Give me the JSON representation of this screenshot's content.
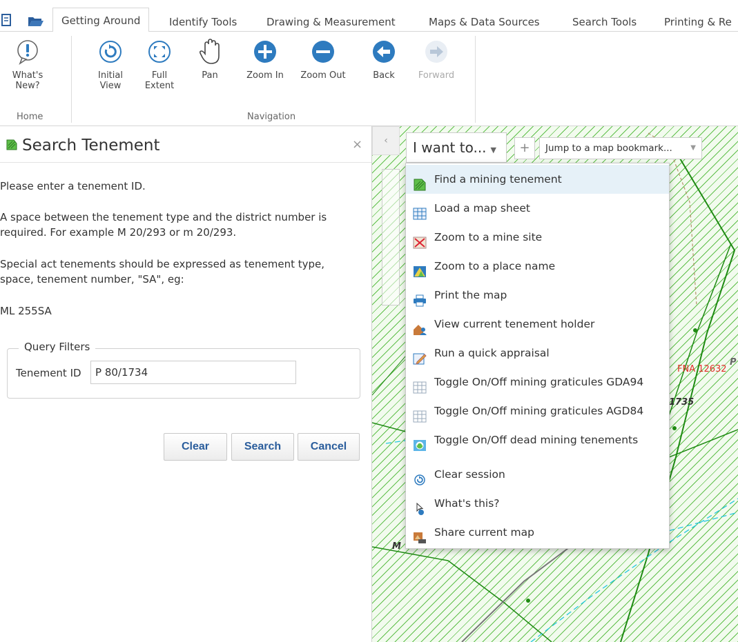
{
  "ribbon": {
    "tabs": [
      {
        "label": "Getting Around",
        "active": true
      },
      {
        "label": "Identify Tools"
      },
      {
        "label": "Drawing & Measurement"
      },
      {
        "label": "Maps & Data Sources"
      },
      {
        "label": "Search Tools"
      },
      {
        "label": "Printing & Re"
      }
    ],
    "buttons": {
      "whats_new": "What's\nNew?",
      "initial_view": "Initial\nView",
      "full_extent": "Full\nExtent",
      "pan": "Pan",
      "zoom_in": "Zoom In",
      "zoom_out": "Zoom Out",
      "back": "Back",
      "forward": "Forward"
    },
    "groups": {
      "home": "Home",
      "navigation": "Navigation"
    },
    "accent_color": "#2e7bbf"
  },
  "panel": {
    "title": "Search Tenement",
    "close_glyph": "×",
    "instructions": [
      "Please enter a tenement ID.",
      "A space between the tenement type and the district number is",
      "required. For example M 20/293 or m 20/293.",
      "Special act tenements should be expressed as tenement type,",
      "space, tenement number, \"SA\", eg:",
      "ML 255SA"
    ],
    "fieldset_legend": "Query Filters",
    "tenement_id_label": "Tenement ID",
    "tenement_id_value": "P 80/1734",
    "buttons": {
      "clear": "Clear",
      "search": "Search",
      "cancel": "Cancel"
    }
  },
  "map": {
    "collapse_glyph": "‹",
    "i_want_to": "I want to...",
    "add_glyph": "+",
    "bookmark_placeholder": "Jump to a map bookmark...",
    "labels": {
      "fna": "FNA 12632",
      "p": "P",
      "n1735": "1735",
      "m": "M"
    },
    "hatch_color": "#5fbf4a",
    "label_red": "#e0302a"
  },
  "menu": {
    "items": [
      {
        "label": "Find a mining tenement",
        "icon": "tenement-icon"
      },
      {
        "label": "Load a map sheet",
        "icon": "grid-sheet-icon"
      },
      {
        "label": "Zoom to a mine site",
        "icon": "mine-site-icon"
      },
      {
        "label": "Zoom to a place name",
        "icon": "place-name-icon"
      },
      {
        "label": "Print the map",
        "icon": "printer-icon"
      },
      {
        "label": "View current tenement holder",
        "icon": "holder-icon"
      },
      {
        "label": "Run a quick appraisal",
        "icon": "appraisal-icon"
      },
      {
        "label": "Toggle On/Off mining graticules GDA94",
        "icon": "graticule-icon"
      },
      {
        "label": "Toggle On/Off mining graticules AGD84",
        "icon": "graticule-icon"
      },
      {
        "label": "Toggle On/Off dead mining tenements",
        "icon": "dead-tenement-icon"
      },
      {
        "label": "Clear session",
        "icon": "clear-session-icon"
      },
      {
        "label": "What's this?",
        "icon": "whats-this-icon"
      },
      {
        "label": "Share current map",
        "icon": "share-icon"
      }
    ]
  }
}
